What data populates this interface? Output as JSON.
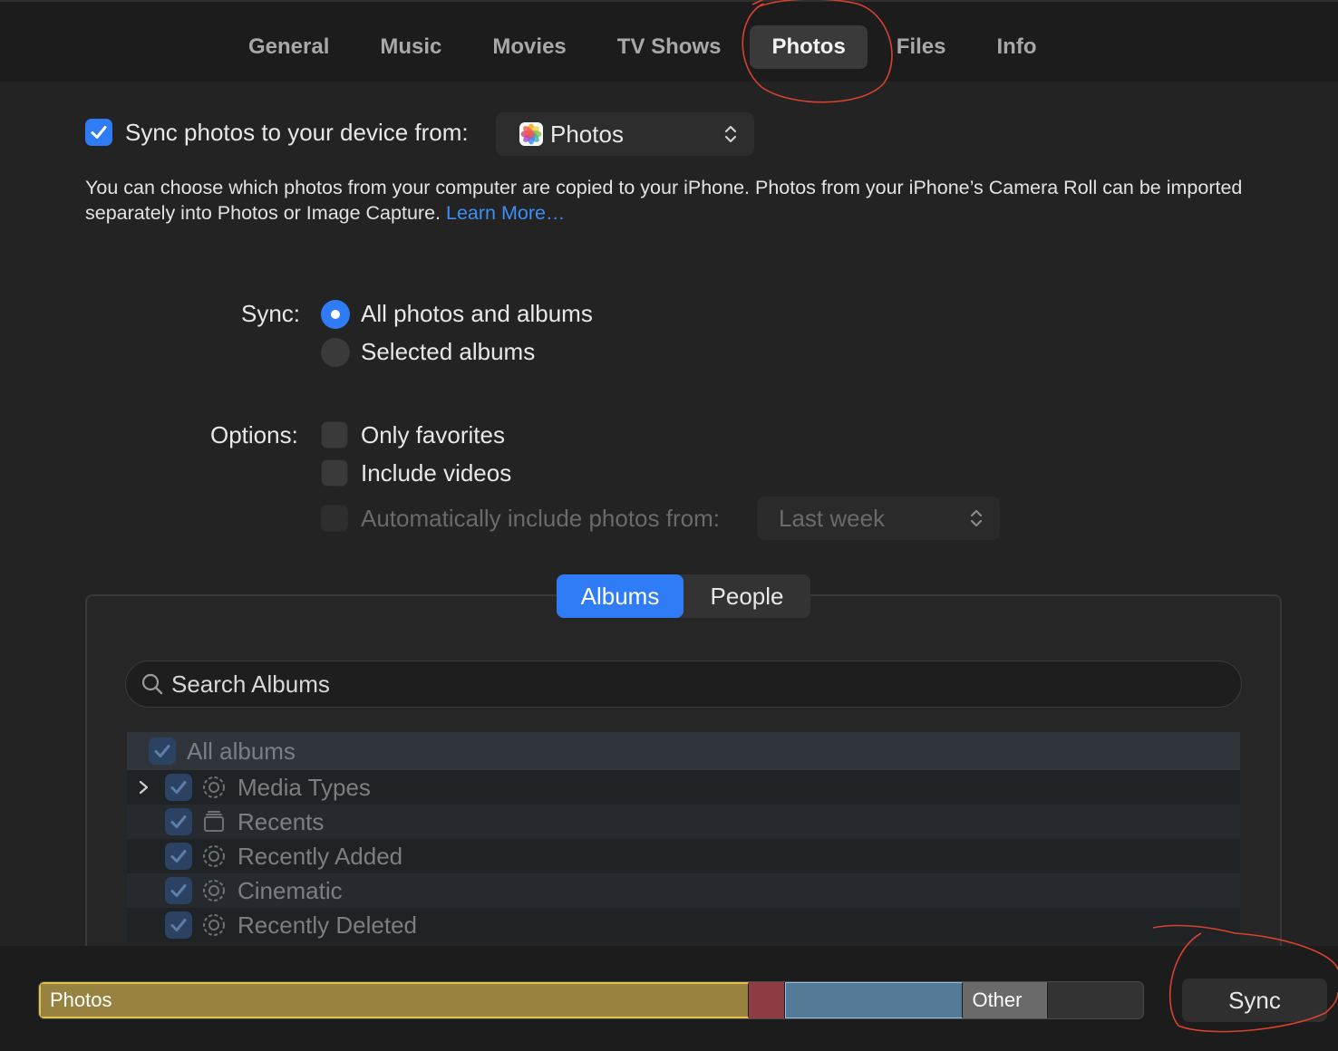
{
  "tabs": [
    "General",
    "Music",
    "Movies",
    "TV Shows",
    "Photos",
    "Files",
    "Info"
  ],
  "active_tab": "Photos",
  "sync_from": {
    "label": "Sync photos to your device from:",
    "checked": true,
    "source": "Photos"
  },
  "description": {
    "text": "You can choose which photos from your computer are copied to your iPhone. Photos from your iPhone’s Camera Roll can be imported separately into Photos or Image Capture.",
    "link": "Learn More…"
  },
  "sync": {
    "label": "Sync:",
    "options": [
      "All photos and albums",
      "Selected albums"
    ],
    "selected": 0
  },
  "options": {
    "label": "Options:",
    "only_favorites": "Only favorites",
    "include_videos": "Include videos",
    "auto_include": "Automatically include photos from:",
    "auto_value": "Last week"
  },
  "segment": {
    "albums": "Albums",
    "people": "People",
    "selected": "Albums"
  },
  "search": {
    "placeholder": "Search Albums"
  },
  "albums": {
    "all": "All albums",
    "items": [
      "Media Types",
      "Recents",
      "Recently Added",
      "Cinematic",
      "Recently Deleted"
    ]
  },
  "storage": {
    "photos_label": "Photos",
    "other_label": "Other",
    "segments": [
      {
        "name": "Photos",
        "fraction": 0.643,
        "color": "#978240"
      },
      {
        "name": "",
        "fraction": 0.033,
        "color": "#8e3c46"
      },
      {
        "name": "",
        "fraction": 0.161,
        "color": "#557a97"
      },
      {
        "name": "Other",
        "fraction": 0.077,
        "color": "#6a6a6a"
      },
      {
        "name": "",
        "fraction": 0.086,
        "color": "#333333"
      }
    ]
  },
  "sync_button": "Sync",
  "colors": {
    "accent": "#2f7cf6",
    "link": "#3d8ef7",
    "annotation": "#d9412e"
  }
}
